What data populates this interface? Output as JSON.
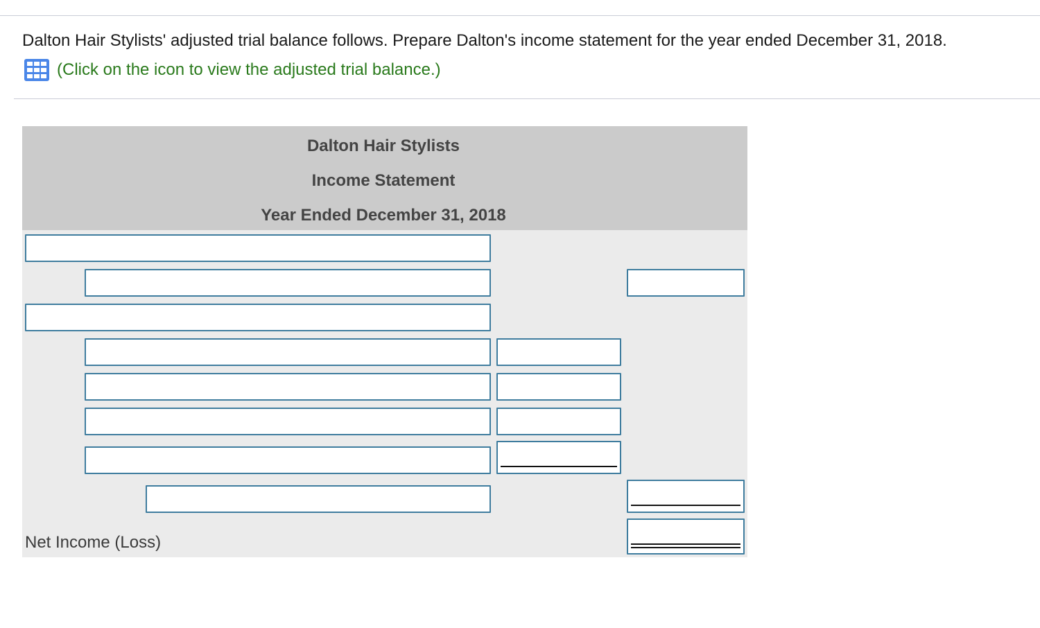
{
  "prompt": {
    "text": "Dalton Hair Stylists' adjusted trial balance follows. Prepare Dalton's income statement for the year ended December 31, 2018.",
    "link_text": "(Click on the icon to view the adjusted trial balance.)",
    "link_icon": "table-grid-icon",
    "link_color": "#2a7a1c",
    "icon_color": "#4a86e8"
  },
  "statement": {
    "company": "Dalton Hair Stylists",
    "title": "Income Statement",
    "period": "Year Ended December 31, 2018",
    "net_income_label": "Net Income (Loss)",
    "rows": [
      {
        "label": "",
        "amount": ""
      },
      {
        "label": "",
        "amount": ""
      },
      {
        "label": "",
        "amount": ""
      },
      {
        "label": "",
        "amount": ""
      },
      {
        "label": "",
        "amount": ""
      },
      {
        "label": "",
        "amount": ""
      },
      {
        "label": "",
        "amount": ""
      },
      {
        "label": "",
        "amount": ""
      }
    ],
    "net_income_amount": ""
  },
  "colors": {
    "header_bg": "#cbcbcb",
    "body_bg": "#ebebeb",
    "field_border": "#3e7c9e"
  }
}
